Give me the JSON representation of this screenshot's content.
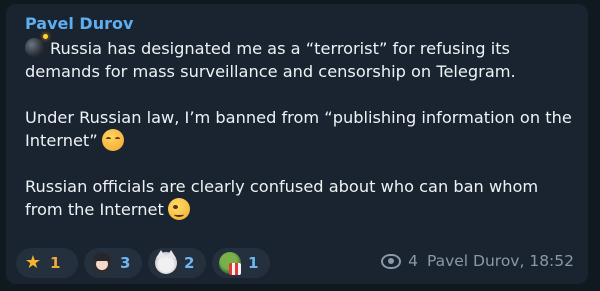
{
  "message": {
    "author": "Pavel Durov",
    "paragraphs": [
      {
        "leading_icon": "bomb-icon",
        "text": "Russia has designated me as a “terrorist” for refusing its demands for mass surveillance and censorship on Telegram."
      },
      {
        "text": "Under Russian law, I’m banned from “publishing information on the Internet”",
        "trailing_icon": "sleepy-face-icon"
      },
      {
        "text": "Russian officials are clearly confused about who can ban whom from the Internet",
        "trailing_icon": "winking-face-icon"
      }
    ]
  },
  "reactions": [
    {
      "icon": "star-icon",
      "count": "1",
      "color": "#f0a93c"
    },
    {
      "icon": "girl-sticker-icon",
      "count": "3",
      "color": "#6fb6f3"
    },
    {
      "icon": "cat-sticker-icon",
      "count": "2",
      "color": "#6fb6f3"
    },
    {
      "icon": "frog-sticker-icon",
      "count": "1",
      "color": "#6fb6f3"
    }
  ],
  "meta": {
    "views_icon": "eye-icon",
    "views": "4",
    "signature_time": "Pavel Durov, 18:52"
  },
  "colors": {
    "background": "#101820",
    "bubble": "#1a2430",
    "author": "#5eaef0",
    "text": "#eef2f6",
    "meta": "#8a98a8"
  }
}
